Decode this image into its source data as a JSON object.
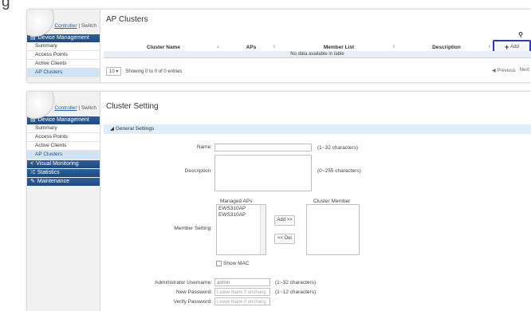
{
  "top_fragment": "g",
  "sidebar": {
    "mode_controller": "Controller",
    "mode_sep": "|",
    "mode_switch": "Switch",
    "sections": [
      "Device Management",
      "Visual Monitoring",
      "Statistics",
      "Maintenance"
    ],
    "items": [
      "Summary",
      "Access Points",
      "Active Clients",
      "AP Clusters"
    ]
  },
  "clusters_page": {
    "title": "AP Clusters",
    "search_icon": "search-icon",
    "add_label": "Add",
    "columns": [
      "Cluster Name",
      "APs",
      "Member List",
      "Description"
    ],
    "empty_text": "No data available in table",
    "page_size": "10",
    "showing_text": "Showing 0 to 0 of 0 entries",
    "previous": "Previous",
    "next": "Next"
  },
  "setting_page": {
    "title": "Cluster Setting",
    "section": "General Settings",
    "name_label": "Name:",
    "name_hint": "(1~32 characters)",
    "desc_label": "Description:",
    "desc_hint": "(0~255 characters)",
    "managed_aps_head": "Managed APs",
    "managed_aps": [
      "EWS310AP",
      "EWS310AP"
    ],
    "cluster_member_head": "Cluster Member",
    "member_setting_label": "Member Setting:",
    "add_btn": "Add >>",
    "del_btn": "<< Del",
    "show_mac": "Show MAC",
    "admin_user_label": "Administrator Username:",
    "admin_user_value": "admin",
    "admin_user_hint": "(1~32 characters)",
    "new_pw_label": "New Password:",
    "new_pw_placeholder": "Leave blank if unchang",
    "new_pw_hint": "(1~12 characters)",
    "verify_pw_label": "Verify Password:",
    "verify_pw_placeholder": "Leave blank if unchang"
  }
}
